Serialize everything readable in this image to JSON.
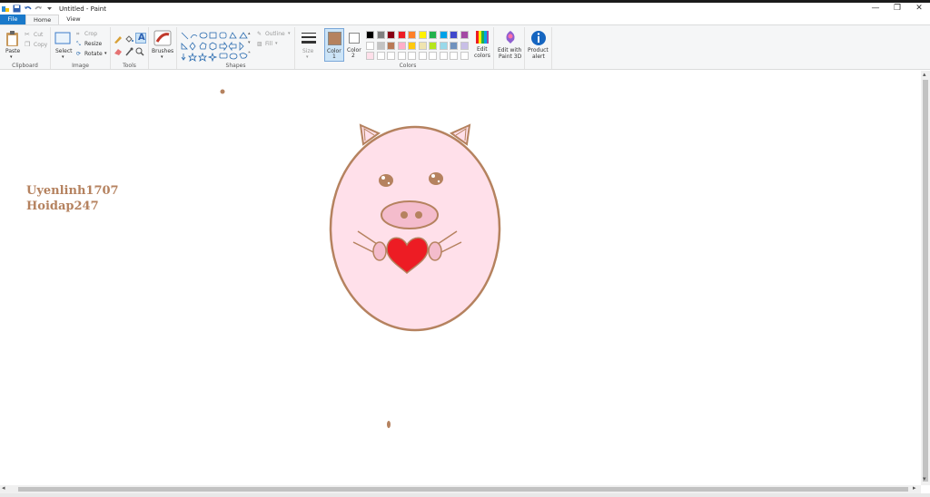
{
  "window": {
    "title": "Untitled - Paint",
    "controls": {
      "minimize": "—",
      "maximize": "❐",
      "close": "✕"
    }
  },
  "tabs": [
    {
      "label": "File"
    },
    {
      "label": "Home"
    },
    {
      "label": "View"
    }
  ],
  "ribbon": {
    "clipboard": {
      "paste": "Paste",
      "cut": "Cut",
      "copy": "Copy",
      "group_label": "Clipboard"
    },
    "image": {
      "select": "Select",
      "crop": "Crop",
      "resize": "Resize",
      "rotate": "Rotate",
      "group_label": "Image"
    },
    "tools": {
      "group_label": "Tools"
    },
    "brushes": {
      "label": "Brushes"
    },
    "shapes": {
      "outline": "Outline",
      "fill": "Fill",
      "group_label": "Shapes"
    },
    "size": {
      "label": "Size"
    },
    "colors": {
      "color1_label": "Color",
      "color1_num": "1",
      "color2_label": "Color",
      "color2_num": "2",
      "edit_colors_1": "Edit",
      "edit_colors_2": "colors",
      "group_label": "Colors",
      "color1_value": "#b5825f",
      "color2_value": "#ffffff",
      "palette_row1": [
        "#000000",
        "#7f7f7f",
        "#880015",
        "#ed1c24",
        "#ff7f27",
        "#fff200",
        "#22b14c",
        "#00a2e8",
        "#3f48cc",
        "#a349a4"
      ],
      "palette_row2": [
        "#ffffff",
        "#c3c3c3",
        "#b97a57",
        "#ffaec9",
        "#ffc90e",
        "#efe4b0",
        "#b5e61d",
        "#99d9ea",
        "#7092be",
        "#c8bfe7"
      ],
      "palette_row3": [
        "#ffe0ea",
        "#ffffff",
        "#ffffff",
        "#ffffff",
        "#ffffff",
        "#ffffff",
        "#ffffff",
        "#ffffff",
        "#ffffff",
        "#ffffff"
      ]
    },
    "paint3d": {
      "line1": "Edit with",
      "line2": "Paint 3D"
    },
    "product_alert": {
      "line1": "Product",
      "line2": "alert"
    }
  },
  "canvas": {
    "watermark_line1": "Uyenlinh1707",
    "watermark_line2": "Hoidap247",
    "drawing": {
      "subject": "pig-face",
      "face_color": "#ffe0ea",
      "outline_color": "#b5825f",
      "nose_color": "#f4bccc",
      "heart_color": "#ed1c24"
    }
  }
}
